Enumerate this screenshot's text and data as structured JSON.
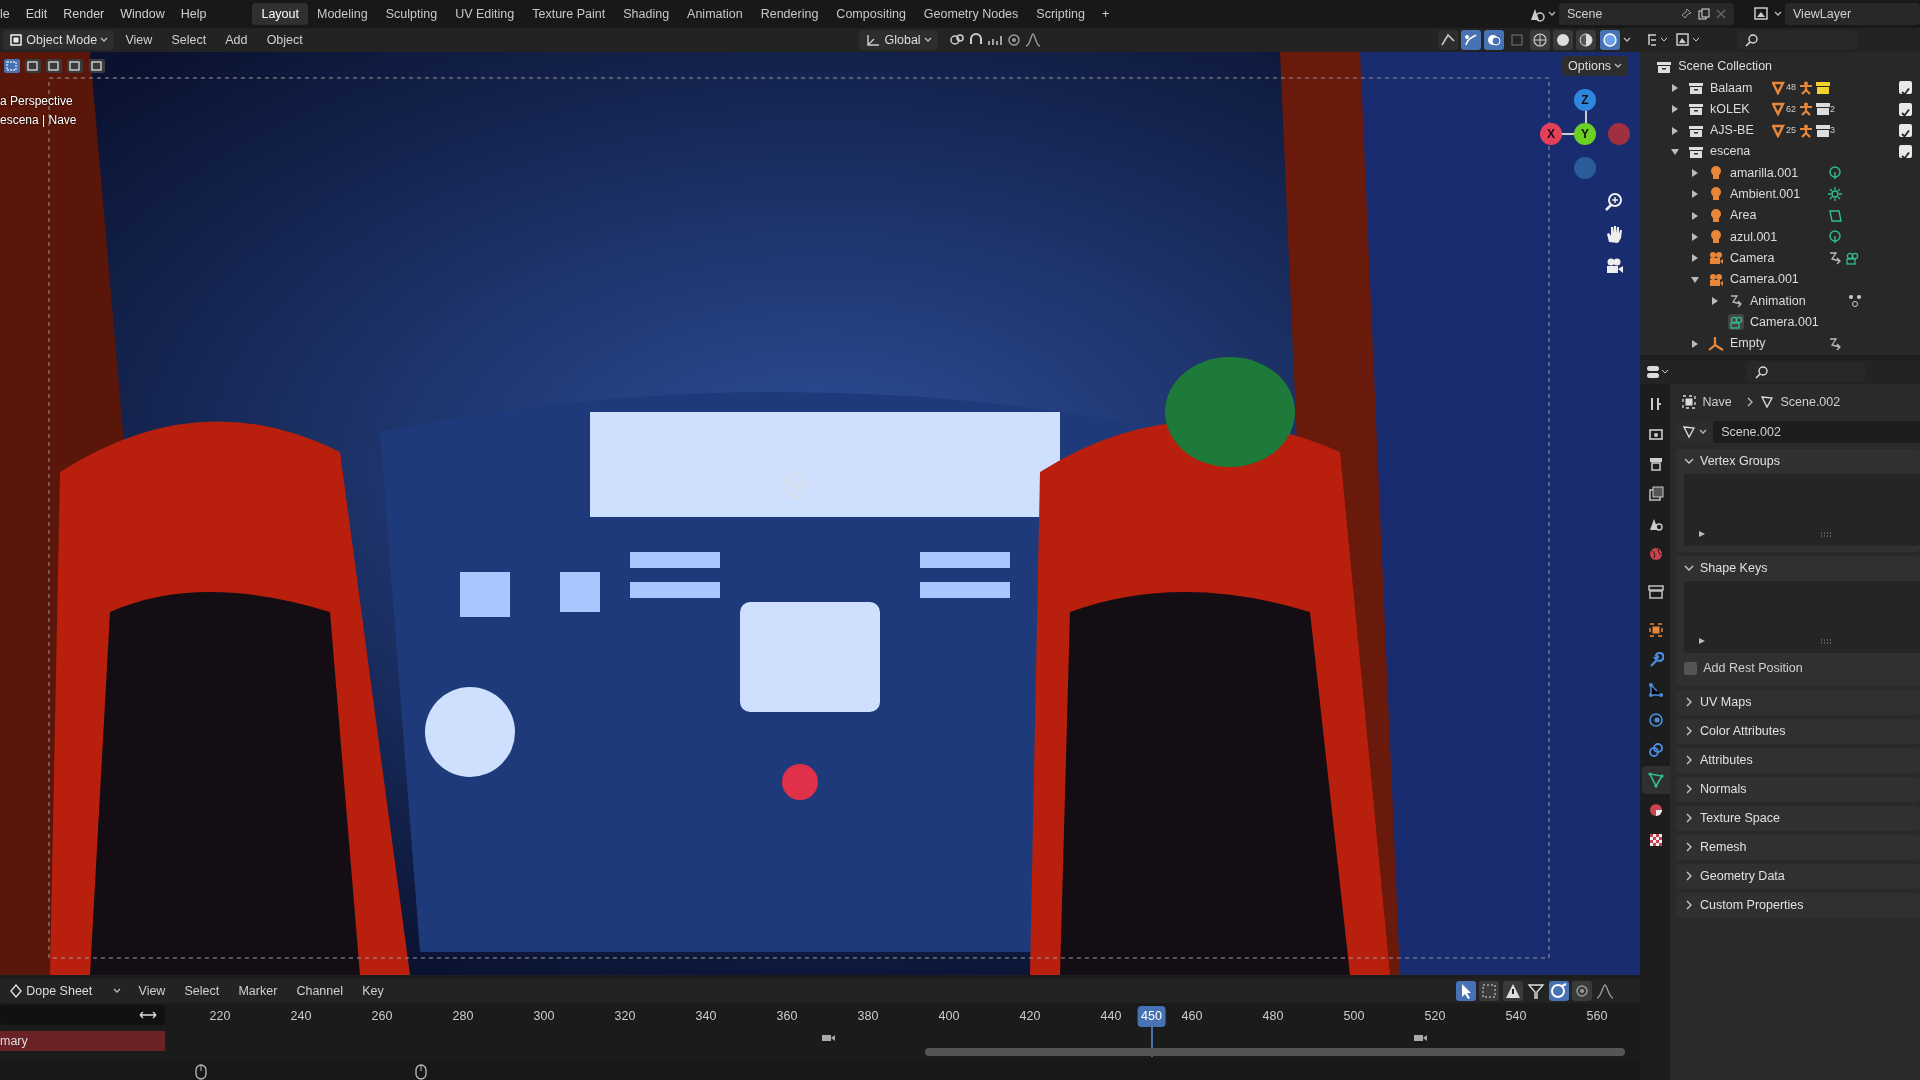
{
  "menu": [
    "le",
    "Edit",
    "Render",
    "Window",
    "Help"
  ],
  "workspaces": [
    {
      "label": "Layout",
      "selected": true
    },
    {
      "label": "Modeling",
      "selected": false
    },
    {
      "label": "Sculpting",
      "selected": false
    },
    {
      "label": "UV Editing",
      "selected": false
    },
    {
      "label": "Texture Paint",
      "selected": false
    },
    {
      "label": "Shading",
      "selected": false
    },
    {
      "label": "Animation",
      "selected": false
    },
    {
      "label": "Rendering",
      "selected": false
    },
    {
      "label": "Compositing",
      "selected": false
    },
    {
      "label": "Geometry Nodes",
      "selected": false
    },
    {
      "label": "Scripting",
      "selected": false
    }
  ],
  "add_workspace": "+",
  "scene": "Scene",
  "view_layer": "ViewLayer",
  "viewport": {
    "mode": "Object Mode",
    "menus": [
      "View",
      "Select",
      "Add",
      "Object"
    ],
    "orientation": "Global",
    "options": "Options",
    "overlay_lines": [
      "a Perspective",
      "escena | Nave"
    ],
    "gizmo_axes": [
      "X",
      "Y",
      "Z"
    ]
  },
  "outliner": {
    "root": "Scene Collection",
    "items": [
      {
        "name": "Balaam",
        "kind": "collection",
        "expanded": false,
        "checked": true,
        "badges": [
          {
            "kind": "mesh",
            "count": "48"
          },
          {
            "kind": "armature"
          },
          {
            "kind": "active-collection"
          }
        ]
      },
      {
        "name": "kOLEK",
        "kind": "collection",
        "expanded": false,
        "checked": true,
        "badges": [
          {
            "kind": "mesh",
            "count": "62"
          },
          {
            "kind": "armature"
          },
          {
            "kind": "collection",
            "count": "2"
          }
        ]
      },
      {
        "name": "AJS-BE",
        "kind": "collection",
        "expanded": false,
        "checked": true,
        "badges": [
          {
            "kind": "mesh",
            "count": "25"
          },
          {
            "kind": "armature"
          },
          {
            "kind": "collection",
            "count": "3"
          }
        ]
      },
      {
        "name": "escena",
        "kind": "collection",
        "expanded": true,
        "checked": true,
        "children": [
          {
            "name": "amarilla.001",
            "kind": "light",
            "expanded": false,
            "badges": [
              {
                "kind": "point-light"
              }
            ]
          },
          {
            "name": "Ambient.001",
            "kind": "light",
            "expanded": false,
            "badges": [
              {
                "kind": "sun-light"
              }
            ]
          },
          {
            "name": "Area",
            "kind": "light",
            "expanded": false,
            "badges": [
              {
                "kind": "area-light"
              }
            ]
          },
          {
            "name": "azul.001",
            "kind": "light",
            "expanded": false,
            "badges": [
              {
                "kind": "point-light"
              }
            ]
          },
          {
            "name": "Camera",
            "kind": "camera",
            "expanded": false,
            "badges": [
              {
                "kind": "action"
              },
              {
                "kind": "camera-data"
              }
            ]
          },
          {
            "name": "Camera.001",
            "kind": "camera",
            "expanded": true,
            "children": [
              {
                "name": "Animation",
                "kind": "action",
                "expanded": false,
                "badges": [
                  {
                    "kind": "keyframes"
                  }
                ]
              },
              {
                "name": "Camera.001",
                "kind": "camera-data"
              }
            ]
          },
          {
            "name": "Empty",
            "kind": "empty",
            "expanded": false,
            "badges": [
              {
                "kind": "action"
              }
            ]
          }
        ]
      }
    ]
  },
  "properties": {
    "tabs": [
      {
        "kind": "tool",
        "selected": false
      },
      {
        "kind": "render",
        "selected": false
      },
      {
        "kind": "output",
        "selected": false
      },
      {
        "kind": "view-layer",
        "selected": false
      },
      {
        "kind": "scene",
        "selected": false
      },
      {
        "kind": "world",
        "selected": false
      },
      {
        "kind": "collection",
        "selected": false
      },
      {
        "kind": "object",
        "selected": false
      },
      {
        "kind": "modifier",
        "selected": false
      },
      {
        "kind": "particles",
        "selected": false
      },
      {
        "kind": "physics",
        "selected": false
      },
      {
        "kind": "constraint",
        "selected": false
      },
      {
        "kind": "data",
        "selected": true
      },
      {
        "kind": "material",
        "selected": false
      },
      {
        "kind": "texture",
        "selected": false
      }
    ],
    "breadcrumb": [
      "Nave",
      "Scene.002"
    ],
    "datablock": "Scene.002",
    "panels": [
      {
        "title": "Vertex Groups",
        "expanded": true,
        "kind": "list"
      },
      {
        "title": "Shape Keys",
        "expanded": true,
        "kind": "list",
        "checkbox": {
          "label": "Add Rest Position",
          "checked": false
        }
      },
      {
        "title": "UV Maps",
        "expanded": false
      },
      {
        "title": "Color Attributes",
        "expanded": false
      },
      {
        "title": "Attributes",
        "expanded": false
      },
      {
        "title": "Normals",
        "expanded": false
      },
      {
        "title": "Texture Space",
        "expanded": false
      },
      {
        "title": "Remesh",
        "expanded": false
      },
      {
        "title": "Geometry Data",
        "expanded": false
      },
      {
        "title": "Custom Properties",
        "expanded": false
      }
    ]
  },
  "timeline": {
    "editor": "Dope Sheet",
    "menus": [
      "View",
      "Select",
      "Marker",
      "Channel",
      "Key"
    ],
    "frames": [
      "220",
      "240",
      "260",
      "280",
      "300",
      "320",
      "340",
      "360",
      "380",
      "400",
      "420",
      "440",
      "460",
      "480",
      "500",
      "520",
      "540",
      "560"
    ],
    "current_frame": "450",
    "channel": "mary"
  }
}
